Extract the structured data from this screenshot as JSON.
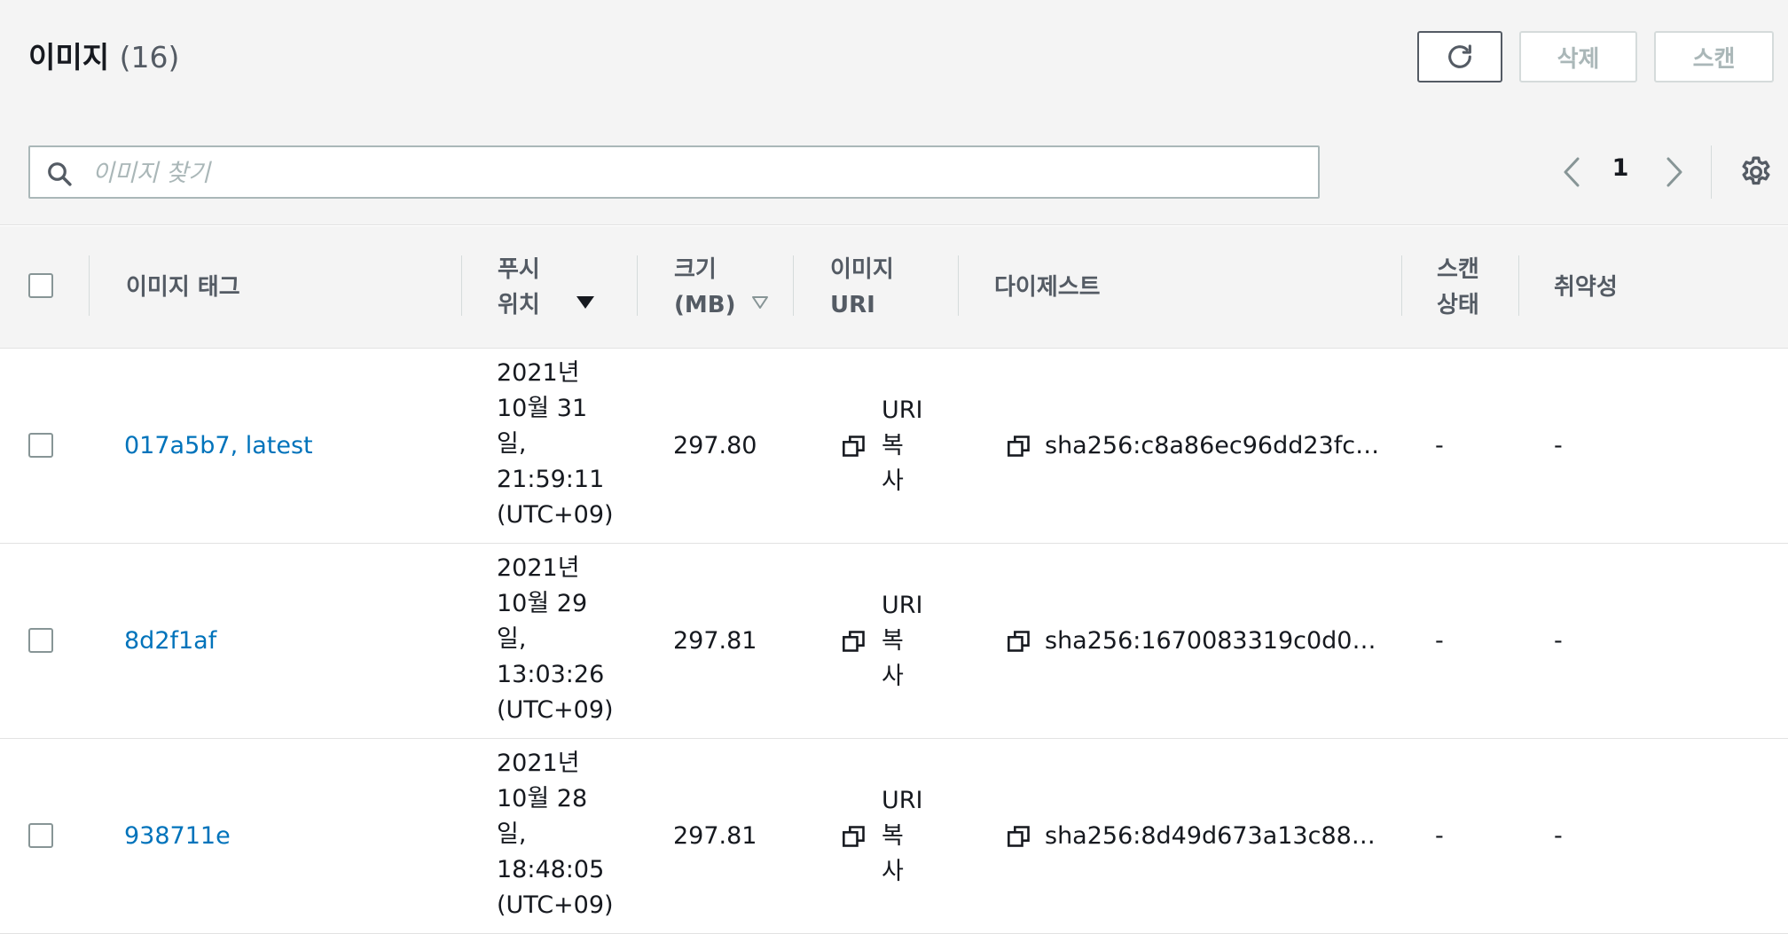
{
  "header": {
    "title": "이미지",
    "count": "(16)",
    "refresh_icon": "refresh-icon",
    "delete_label": "삭제",
    "scan_label": "스캔"
  },
  "search": {
    "placeholder": "이미지 찾기",
    "icon": "search-icon"
  },
  "pagination": {
    "current_page": "1",
    "prev_icon": "chevron-left-icon",
    "next_icon": "chevron-right-icon",
    "settings_icon": "gear-icon"
  },
  "table": {
    "columns": {
      "tag": "이미지 태그",
      "pushed_line1": "푸시",
      "pushed_line2": "위치",
      "size_line1": "크기",
      "size_line2": "(MB)",
      "uri_line1": "이미지",
      "uri_line2": "URI",
      "digest": "다이제스트",
      "scan_line1": "스캔",
      "scan_line2": "상태",
      "vulns": "취약성"
    },
    "sort": {
      "pushed": "sort-descending-icon",
      "size": "sort-unsorted-icon"
    },
    "rows": [
      {
        "tag": "017a5b7, latest",
        "pushed": [
          "2021년",
          "10월 31",
          "일,",
          "21:59:11",
          "(UTC+09)"
        ],
        "size": "297.80",
        "uri_copy": [
          "URI",
          "복",
          "사"
        ],
        "digest": "sha256:c8a86ec96dd23fc…",
        "scan_status": "-",
        "vulnerabilities": "-"
      },
      {
        "tag": "8d2f1af",
        "pushed": [
          "2021년",
          "10월 29",
          "일,",
          "13:03:26",
          "(UTC+09)"
        ],
        "size": "297.81",
        "uri_copy": [
          "URI",
          "복",
          "사"
        ],
        "digest": "sha256:1670083319c0d0…",
        "scan_status": "-",
        "vulnerabilities": "-"
      },
      {
        "tag": "938711e",
        "pushed": [
          "2021년",
          "10월 28",
          "일,",
          "18:48:05",
          "(UTC+09)"
        ],
        "size": "297.81",
        "uri_copy": [
          "URI",
          "복",
          "사"
        ],
        "digest": "sha256:8d49d673a13c88…",
        "scan_status": "-",
        "vulnerabilities": "-"
      }
    ]
  }
}
